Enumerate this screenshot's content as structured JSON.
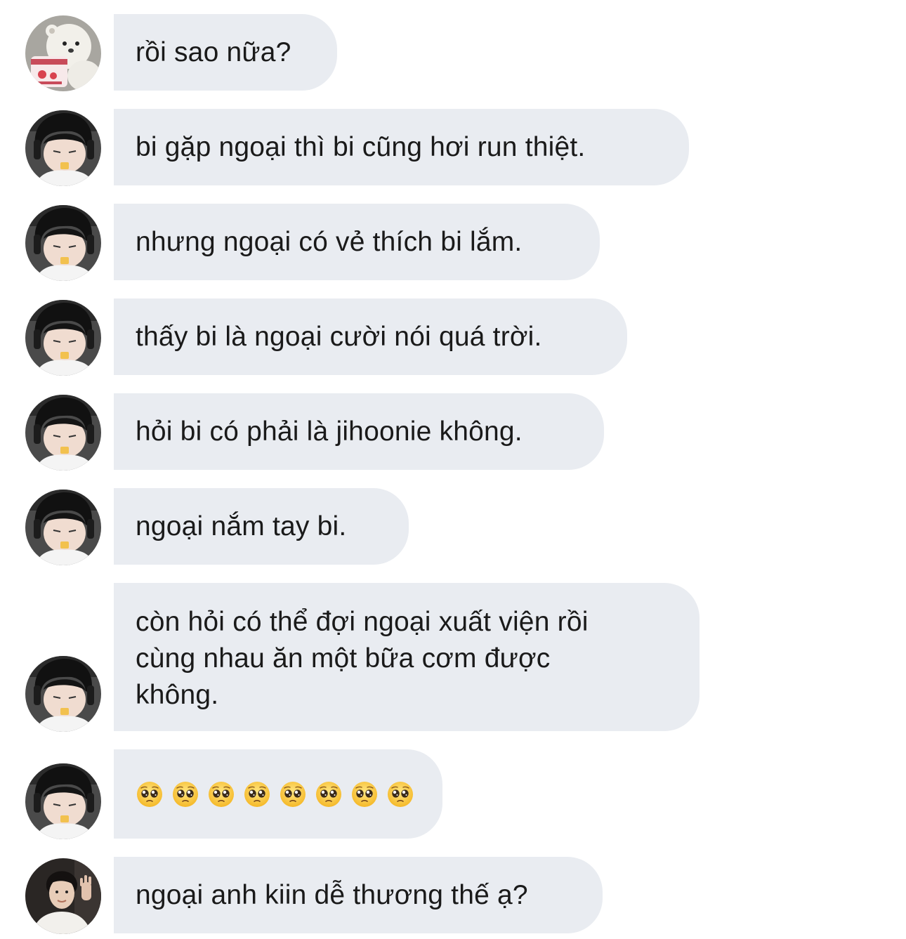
{
  "messages": [
    {
      "avatar": "bear-avatar",
      "text": "rồi sao nữa?"
    },
    {
      "avatar": "boy-avatar",
      "text": "bi gặp ngoại thì bi cũng hơi run thiệt."
    },
    {
      "avatar": "boy-avatar",
      "text": "nhưng ngoại có vẻ thích bi lắm."
    },
    {
      "avatar": "boy-avatar",
      "text": "thấy bi là ngoại cười nói quá trời."
    },
    {
      "avatar": "boy-avatar",
      "text": "hỏi bi có phải là jihoonie không."
    },
    {
      "avatar": "boy-avatar",
      "text": "ngoại nắm tay bi."
    },
    {
      "avatar": "boy-avatar",
      "text": "còn hỏi có thể đợi ngoại xuất viện rồi\ncùng nhau ăn một bữa cơm được\nkhông."
    },
    {
      "avatar": "boy-avatar",
      "emoji": "pleading-face",
      "emoji_count": 8
    },
    {
      "avatar": "man-avatar",
      "text": "ngoại anh kiin dễ thương thế ạ?"
    }
  ],
  "colors": {
    "bubble": "#e9ecf1",
    "text": "#1a1a1a",
    "background": "#ffffff"
  }
}
